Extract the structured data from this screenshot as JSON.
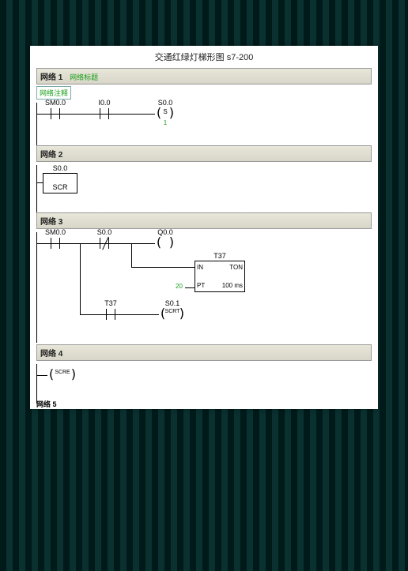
{
  "title": "交通红绿灯梯形图 s7-200",
  "networks": [
    {
      "label": "网络 1",
      "title": "网络标题",
      "comment": "网络注释",
      "elements": {
        "c1": "SM0.0",
        "c2": "I0.0",
        "coil": "S0.0",
        "coil_inner": "S",
        "coil_below": "1"
      }
    },
    {
      "label": "网络 2",
      "elements": {
        "scr_lbl": "S0.0",
        "scr_txt": "SCR"
      }
    },
    {
      "label": "网络 3",
      "elements": {
        "c1": "SM0.0",
        "c2": "S0.0",
        "coil1": "Q0.0",
        "timer_lbl": "T37",
        "timer_in": "IN",
        "timer_ton": "TON",
        "timer_pt": "PT",
        "timer_tb": "100 ms",
        "pt_val": "20",
        "c3": "T37",
        "coil2": "S0.1",
        "coil2_inner": "SCRT"
      }
    },
    {
      "label": "网络 4",
      "elements": {
        "coil_inner": "SCRE"
      }
    },
    {
      "label": "网络 5"
    }
  ],
  "chart_data": {
    "type": "table",
    "plc_ladder": [
      {
        "network": 1,
        "rung": "SM0.0 --| |-- I0.0 --| |-- (S) S0.0 count=1"
      },
      {
        "network": 2,
        "rung": "SCR S0.0"
      },
      {
        "network": 3,
        "rung": "SM0.0 --| |-- S0.0 --|/|-- ( ) Q0.0 ; branch -> T37 TON IN, PT=20, base=100ms ; branch T37 --| |-- (SCRT) S0.1"
      },
      {
        "network": 4,
        "rung": "(SCRE)"
      }
    ]
  }
}
